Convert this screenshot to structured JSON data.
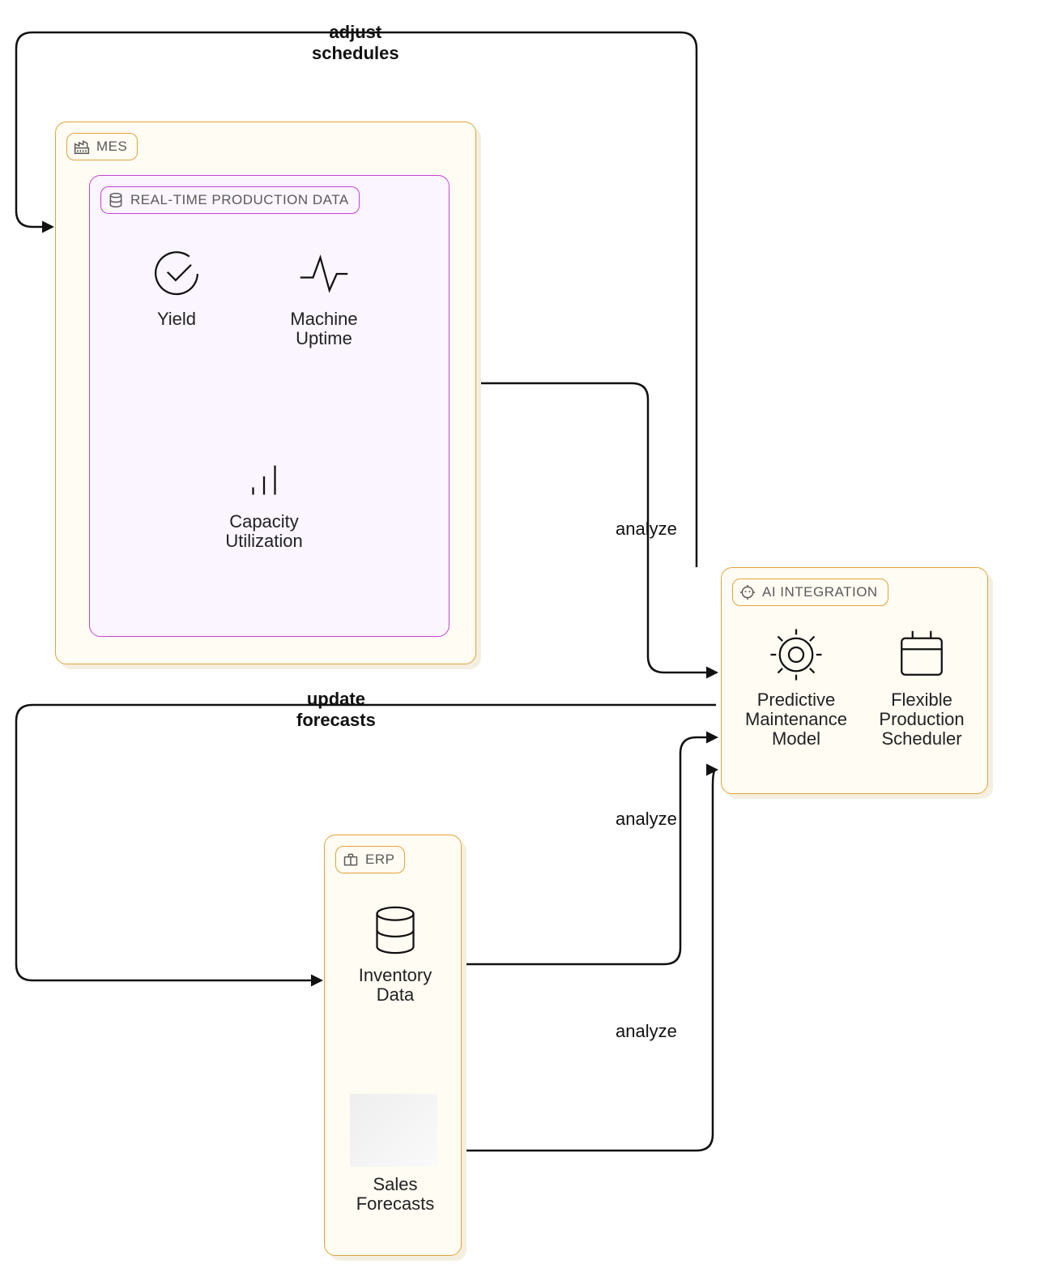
{
  "panels": {
    "mes": {
      "label": "MES"
    },
    "rtpd": {
      "label": "REAL-TIME PRODUCTION DATA"
    },
    "erp": {
      "label": "ERP"
    },
    "ai": {
      "label": "AI INTEGRATION"
    }
  },
  "nodes": {
    "yield": {
      "label": "Yield"
    },
    "uptime": {
      "label": "Machine\nUptime"
    },
    "capacity": {
      "label": "Capacity\nUtilization"
    },
    "inventory": {
      "label": "Inventory\nData"
    },
    "sales": {
      "label": "Sales\nForecasts"
    },
    "pmm": {
      "label": "Predictive\nMaintenance\nModel"
    },
    "fps": {
      "label": "Flexible\nProduction\nScheduler"
    }
  },
  "edges": {
    "adjust_schedules": {
      "label": "adjust\nschedules"
    },
    "update_forecasts": {
      "label": "update\nforecasts"
    },
    "analyze_mes": {
      "label": "analyze"
    },
    "analyze_inv": {
      "label": "analyze"
    },
    "analyze_sales": {
      "label": "analyze"
    }
  }
}
